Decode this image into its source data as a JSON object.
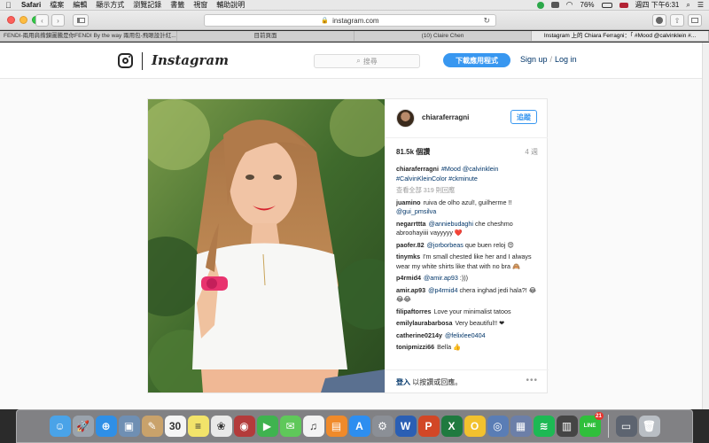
{
  "menubar": {
    "apple_icon": "apple-logo",
    "app_name": "Safari",
    "menus": [
      "檔案",
      "編輯",
      "顯示方式",
      "瀏覽記錄",
      "書籤",
      "視窗",
      "輔助說明"
    ],
    "battery": "76%",
    "clock": "週四 下午6:31"
  },
  "toolbar": {
    "url": "instagram.com",
    "back": "‹",
    "forward": "›"
  },
  "tabs": [
    "FENDI-兩用肩揹鍊圖騰是你FENDI By the way 兩用包-飛眼設計紅...",
    "目前頁面",
    "(10) Claire Chen",
    "Instagram 上的 Chiara Ferragni：「 #Mood @calvinklein #..."
  ],
  "instagram": {
    "wordmark": "Instagram",
    "search_placeholder": "搜尋",
    "download_label": "下載應用程式",
    "signup_label": "Sign up",
    "login_label": "Log in",
    "auth_separator": "/"
  },
  "post": {
    "author": "chiaraferragni",
    "follow_label": "追蹤",
    "likes": "81.5k 個讚",
    "age": "4 週",
    "caption_user": "chiaraferragni",
    "caption_text": "#Mood @calvinklein #CalvinKleinColor #ckminute",
    "load_more": "查看全部 319 則回應",
    "comments": [
      {
        "user": "juamino",
        "pre": "ruiva de olho azul!, guilherme !!",
        "mention": "@gui_pmsilva",
        "post": ""
      },
      {
        "user": "negarrttta",
        "pre": "",
        "mention": "@anniebudaghi",
        "post": "che cheshmo abroohayiiii vayyyyy ❤️"
      },
      {
        "user": "paofer.82",
        "pre": "",
        "mention": "@jorborbeas",
        "post": "que buen reloj 😍"
      },
      {
        "user": "tinymks",
        "pre": "I'm small chested like her and I always wear my white shirts like that with no bra 🙈",
        "mention": "",
        "post": ""
      },
      {
        "user": "p4rmid4",
        "pre": "",
        "mention": "@amir.ap93",
        "post": ":)))"
      },
      {
        "user": "amir.ap93",
        "pre": "",
        "mention": "@p4rmid4",
        "post": "chera inghad jedi hala?! 😂😂😂"
      },
      {
        "user": "filipaftorres",
        "pre": "Love your minimalist tatoos",
        "mention": "",
        "post": ""
      },
      {
        "user": "emilylaurabarbosa",
        "pre": "Very beautiful!! ❤",
        "mention": "",
        "post": ""
      },
      {
        "user": "catherine0214y",
        "pre": "",
        "mention": "@felixlee0404",
        "post": ""
      },
      {
        "user": "tonipmizzi66",
        "pre": "Bella 👍",
        "mention": "",
        "post": ""
      }
    ],
    "login_prompt_link": "登入",
    "login_prompt_rest": " 以按讚或回應。",
    "more_label": "•••"
  },
  "dock": {
    "items": [
      {
        "name": "finder",
        "bg": "#4aa3e8",
        "glyph": "☺"
      },
      {
        "name": "launchpad",
        "bg": "#9aa3ad",
        "glyph": "🚀"
      },
      {
        "name": "safari",
        "bg": "#2f8fe6",
        "glyph": "⊕"
      },
      {
        "name": "preview",
        "bg": "#6f8fb3",
        "glyph": "▣"
      },
      {
        "name": "notes",
        "bg": "#c9a26b",
        "glyph": "✎"
      },
      {
        "name": "calendar",
        "bg": "#f5f5f5",
        "glyph": "30"
      },
      {
        "name": "stickies",
        "bg": "#f2e36a",
        "glyph": "≡"
      },
      {
        "name": "photos-app",
        "bg": "#e9e9e9",
        "glyph": "❀"
      },
      {
        "name": "photo-booth",
        "bg": "#b33b3b",
        "glyph": "◉"
      },
      {
        "name": "facetime",
        "bg": "#3fb34f",
        "glyph": "▶"
      },
      {
        "name": "messages",
        "bg": "#5fc85a",
        "glyph": "✉"
      },
      {
        "name": "itunes",
        "bg": "#f3f3f3",
        "glyph": "♫"
      },
      {
        "name": "ibooks",
        "bg": "#f08a2a",
        "glyph": "▤"
      },
      {
        "name": "app-store",
        "bg": "#2d8ef0",
        "glyph": "A"
      },
      {
        "name": "system-preferences",
        "bg": "#8b8f96",
        "glyph": "⚙"
      },
      {
        "name": "word",
        "bg": "#2b5fb4",
        "glyph": "W"
      },
      {
        "name": "powerpoint",
        "bg": "#d24726",
        "glyph": "P"
      },
      {
        "name": "excel",
        "bg": "#1f7a3f",
        "glyph": "X"
      },
      {
        "name": "outlook",
        "bg": "#f2c12e",
        "glyph": "O"
      },
      {
        "name": "network-app",
        "bg": "#5a7db5",
        "glyph": "◎"
      },
      {
        "name": "virtualbox",
        "bg": "#6c7fa8",
        "glyph": "▦"
      },
      {
        "name": "spotify",
        "bg": "#1db954",
        "glyph": "≋"
      },
      {
        "name": "calculator",
        "bg": "#454545",
        "glyph": "▥"
      },
      {
        "name": "line",
        "bg": "#2fbf3b",
        "glyph": "LINE",
        "badge": "21"
      }
    ],
    "right_items": [
      {
        "name": "folder",
        "bg": "#5d6470",
        "glyph": "▭"
      },
      {
        "name": "trash",
        "bg": "#b9bec4",
        "glyph": "🗑"
      }
    ]
  },
  "colors": {
    "instagram_blue": "#3897f0",
    "link_dark_blue": "#003569"
  }
}
